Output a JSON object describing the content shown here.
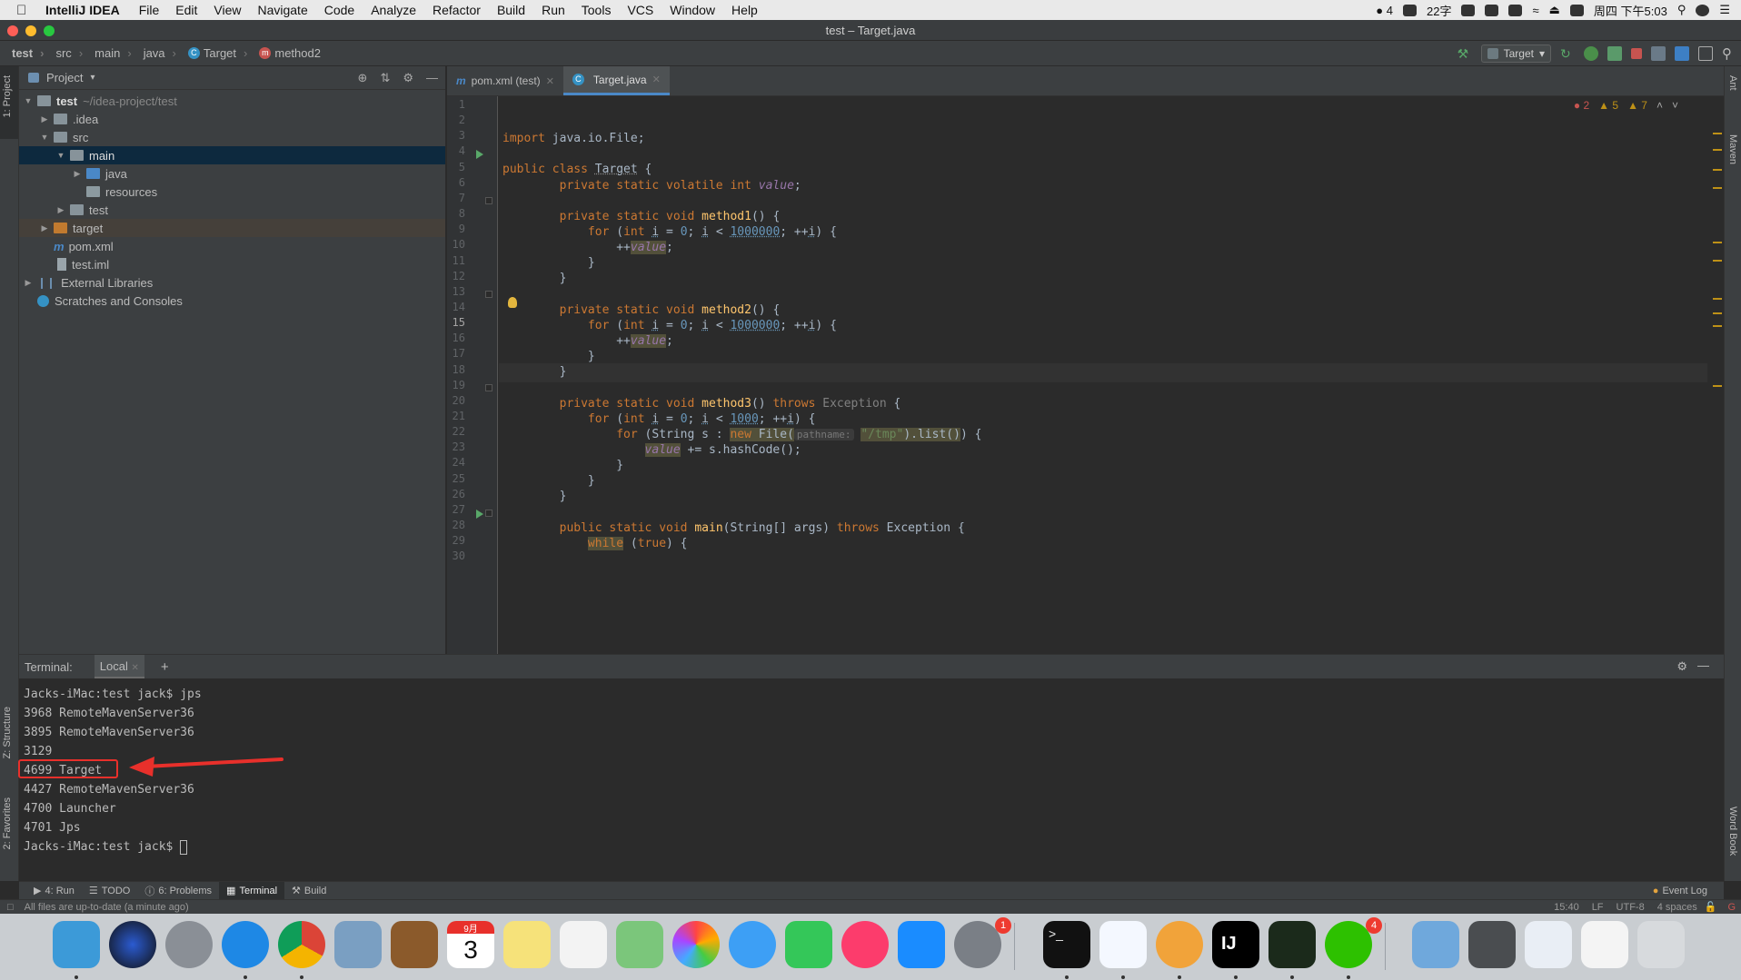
{
  "menubar": {
    "app_name": "IntelliJ IDEA",
    "items": [
      "File",
      "Edit",
      "View",
      "Navigate",
      "Code",
      "Analyze",
      "Refactor",
      "Build",
      "Run",
      "Tools",
      "VCS",
      "Window",
      "Help"
    ],
    "wechat_count": "4",
    "temp": "22字",
    "datetime": "周四 下午5:03"
  },
  "window": {
    "title": "test – Target.java"
  },
  "breadcrumb": [
    "test",
    "src",
    "main",
    "java",
    "Target",
    "method2"
  ],
  "run_config": "Target",
  "project_panel": {
    "title": "Project",
    "tree": [
      {
        "label": "test",
        "extra": "~/idea-project/test",
        "bold": true
      },
      {
        "label": ".idea"
      },
      {
        "label": "src"
      },
      {
        "label": "main"
      },
      {
        "label": "java"
      },
      {
        "label": "resources"
      },
      {
        "label": "test"
      },
      {
        "label": "target"
      },
      {
        "label": "pom.xml"
      },
      {
        "label": "test.iml"
      },
      {
        "label": "External Libraries"
      },
      {
        "label": "Scratches and Consoles"
      }
    ]
  },
  "tabs": [
    "pom.xml (test)",
    "Target.java"
  ],
  "inspections": {
    "errors": "2",
    "warnings": "5",
    "weak": "7"
  },
  "editor": {
    "line_numbers": [
      "1",
      "2",
      "3",
      "4",
      "5",
      "6",
      "7",
      "8",
      "9",
      "10",
      "11",
      "12",
      "13",
      "14",
      "15",
      "16",
      "17",
      "18",
      "19",
      "20",
      "21",
      "22",
      "23",
      "24",
      "25",
      "26",
      "27",
      "28",
      "29",
      "30"
    ],
    "current_line": "15",
    "hint_pathname": "pathname:"
  },
  "terminal": {
    "label": "Terminal:",
    "tab": "Local",
    "add": "+",
    "lines": [
      "Jacks-iMac:test jack$ jps",
      "3968 RemoteMavenServer36",
      "3895 RemoteMavenServer36",
      "3129",
      "4699 Target",
      "4427 RemoteMavenServer36",
      "4700 Launcher",
      "4701 Jps",
      "Jacks-iMac:test jack$ "
    ]
  },
  "bottom_tabs": [
    "4: Run",
    "TODO",
    "6: Problems",
    "Terminal",
    "Build"
  ],
  "event_log": "Event Log",
  "status": {
    "message": "All files are up-to-date (a minute ago)",
    "position": "15:40",
    "line_sep": "LF",
    "encoding": "UTF-8",
    "indent": "4 spaces"
  },
  "stripes": {
    "left_top": "1: Project",
    "left_mid": "Z: Structure",
    "left_bot": "2: Favorites",
    "right_top": "Ant",
    "right_mid": "Maven",
    "right_bot": "Word Book"
  },
  "dock": {
    "calendar_month": "9月",
    "calendar_day": "3",
    "sysprefs_badge": "1",
    "wechat_badge": "4"
  },
  "colors": {
    "accent": "#4a88c7",
    "keyword": "#cc7832",
    "number": "#6897bb",
    "field": "#9876aa",
    "method": "#ffc66d",
    "string": "#6a8759",
    "annotation_red": "#e8302b"
  }
}
